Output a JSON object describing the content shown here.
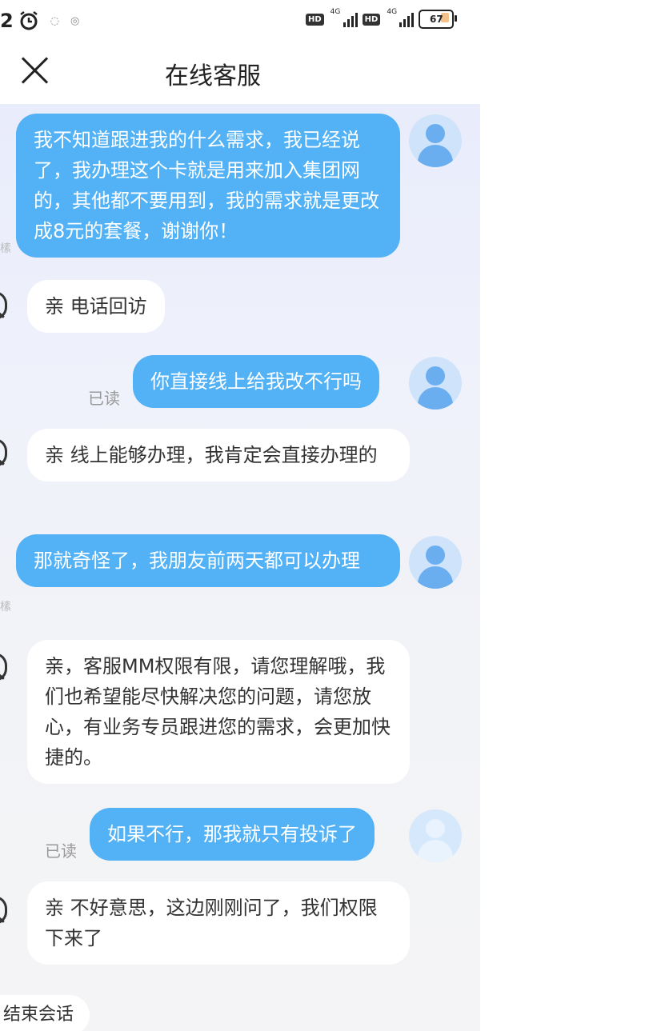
{
  "status_bar": {
    "time": "2",
    "network1": "4G",
    "network2": "4G",
    "hd": "HD",
    "battery": "67"
  },
  "header": {
    "title": "在线客服"
  },
  "messages": [
    {
      "from": "user",
      "text": "我不知道跟进我的什么需求，我已经说了，我办理这个卡就是用来加入集团网的，其他都不要用到，我的需求就是更改成8元的套餐，谢谢你！"
    },
    {
      "from": "agent",
      "text": "亲 电话回访"
    },
    {
      "from": "user",
      "text": "你直接线上给我改不行吗",
      "status": "已读"
    },
    {
      "from": "agent",
      "text": "亲 线上能够办理，我肯定会直接办理的"
    },
    {
      "from": "user",
      "text": "那就奇怪了，我朋友前两天都可以办理"
    },
    {
      "from": "agent",
      "text": "亲，客服MM权限有限，请您理解哦，我们也希望能尽快解决您的问题，请您放心，有业务专员跟进您的需求，会更加快捷的。"
    },
    {
      "from": "user",
      "text": "如果不行，那我就只有投诉了",
      "status": "已读"
    },
    {
      "from": "agent",
      "text": "亲 不好意思，这边刚刚问了，我们权限下来了"
    }
  ],
  "end_session_label": "结束会话",
  "colors": {
    "user_bubble": "#52b2f5",
    "agent_bubble": "#ffffff"
  },
  "icons": {
    "close": "close-icon",
    "alarm": "alarm-icon",
    "avatar": "user-avatar-icon"
  }
}
